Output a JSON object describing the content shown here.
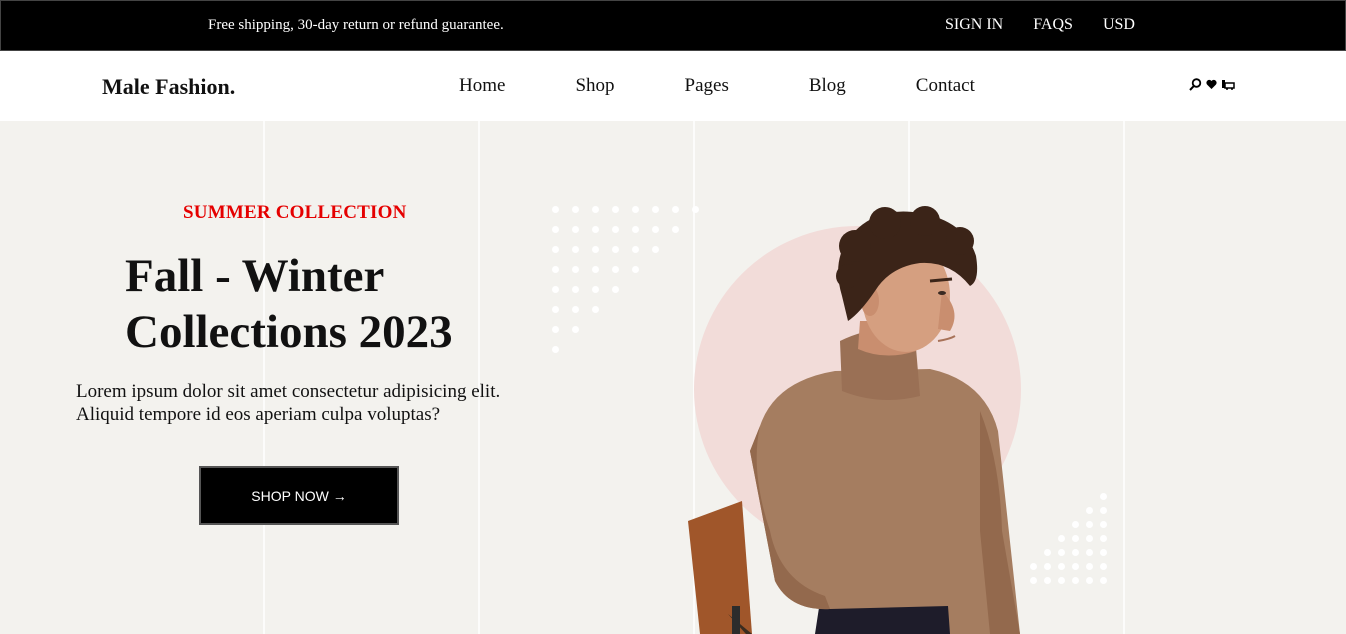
{
  "topbar": {
    "shipping_text": "Free shipping, 30-day return or refund guarantee.",
    "links": [
      "SIGN IN",
      "FAQS",
      "USD"
    ]
  },
  "header": {
    "logo": "Male Fashion.",
    "nav": [
      "Home",
      "Shop",
      "Pages",
      "Blog",
      "Contact"
    ],
    "icons": [
      "search-icon",
      "heart-icon",
      "cart-icon"
    ]
  },
  "hero": {
    "eyebrow": "SUMMER COLLECTION",
    "title_line1": "Fall - Winter",
    "title_line2": "Collections 2023",
    "lead_line1": "Lorem ipsum dolor sit amet consectetur adipisicing elit.",
    "lead_line2": "Aliquid tempore id eos aperiam culpa voluptas?",
    "button_label": "SHOP NOW →"
  },
  "colors": {
    "topbar_bg": "#000000",
    "hero_bg": "#f3f2ee",
    "accent_red": "#e50000",
    "circle_pink": "#f2dcd9",
    "sweater_brown": "#a57d60"
  }
}
